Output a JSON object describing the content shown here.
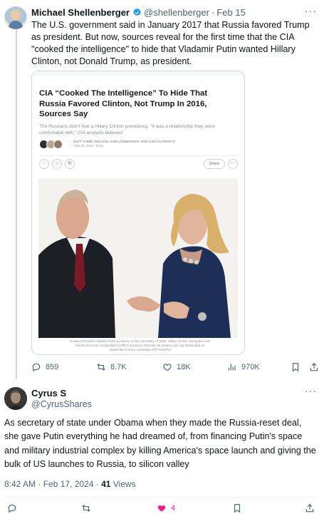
{
  "tweet1": {
    "name": "Michael Shellenberger",
    "handle": "@shellenberger",
    "separator": "·",
    "date": "Feb 15",
    "text": "The U.S. government said in January 2017 that Russia favored Trump as president. But now, sources reveal for the first time that the CIA \"cooked the intelligence\" to hide that Vladamir Putin wanted Hillary Clinton, not Donald Trump, as president.",
    "more": "···",
    "article": {
      "title": "CIA “Cooked The Intelligence” To Hide That Russia Favored Clinton, Not Trump In 2016, Sources Say",
      "subtitle": "The Russians didn't fear a Hillary Clinton presidency. \"It was a relationship they were comfortable with,\" CIA analysts believed",
      "authors": "MATT TAIBBI, MICHAEL SHELLENBERGER, AND ALEX GUTENTAG",
      "article_date": "FEB 15, 2024 · PAID",
      "share_label": "Share",
      "caption": "Russian President Vladimir Putin (L) listens to then Secretary of State, Hillary Clinton, during the Asia-Pacific Economic Cooperation (APEC) Summit in Russia's far eastern port city Vladivostok on September 8 2012. Australian APP PHOTO /"
    },
    "stats": {
      "replies": "859",
      "retweets": "8.7K",
      "likes": "18K",
      "views": "970K"
    }
  },
  "tweet2": {
    "name": "Cyrus S",
    "handle": "@CyrusShares",
    "text": "As secretary of state under Obama when they made the Russia-reset deal, she gave Putin everything he had dreamed of, from financing Putin's space and military industrial complex by killing America's space launch and giving the bulk of US launches to Russia, to silicon valley",
    "timestamp": "8:42 AM · Feb 17, 2024 · ",
    "views_count": "41",
    "views_label": " Views",
    "more": "···",
    "like_count": "4"
  },
  "colors": {
    "text": "#0f1419",
    "secondary": "#536471",
    "verified": "#1d9bf0",
    "like": "#f91880",
    "border": "#cfd9de"
  }
}
